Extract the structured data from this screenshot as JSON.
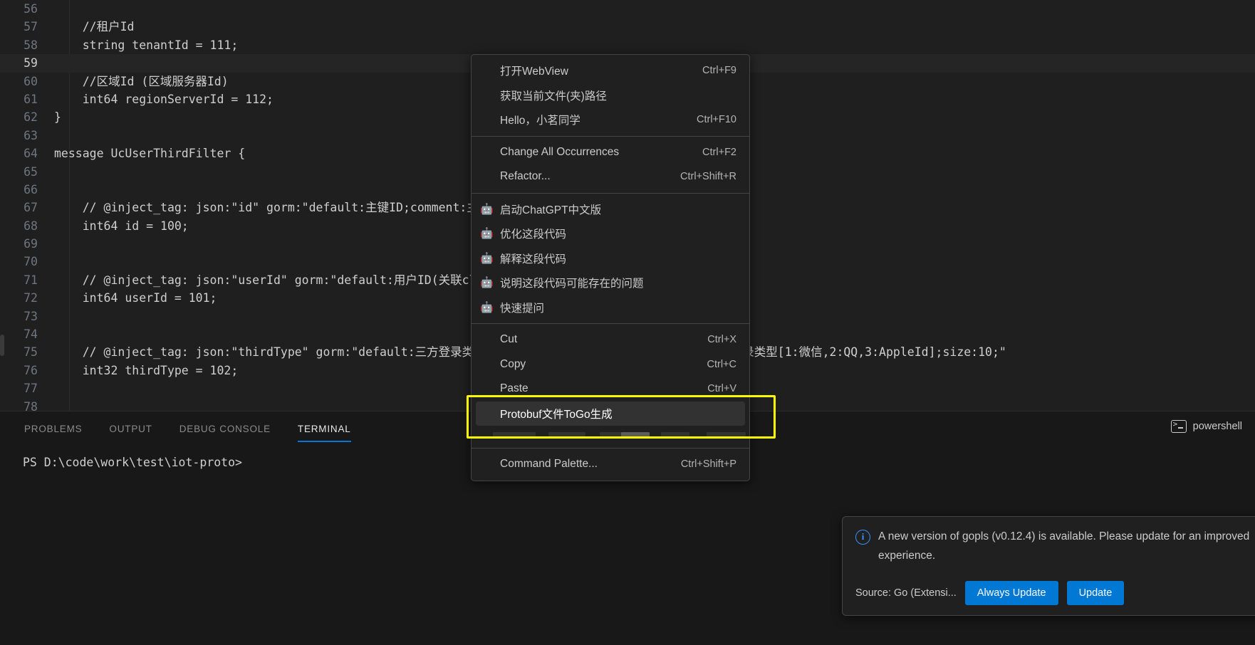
{
  "editor": {
    "lines": [
      {
        "n": "56",
        "text": "",
        "current": false
      },
      {
        "n": "57",
        "text": "    //租户Id",
        "current": false
      },
      {
        "n": "58",
        "text": "    string tenantId = 111;",
        "current": false
      },
      {
        "n": "59",
        "text": "",
        "current": true
      },
      {
        "n": "60",
        "text": "    //区域Id (区域服务器Id)",
        "current": false
      },
      {
        "n": "61",
        "text": "    int64 regionServerId = 112;",
        "current": false
      },
      {
        "n": "62",
        "text": "}",
        "current": false
      },
      {
        "n": "63",
        "text": "",
        "current": false
      },
      {
        "n": "64",
        "text": "message UcUserThirdFilter {",
        "current": false
      },
      {
        "n": "65",
        "text": "",
        "current": false
      },
      {
        "n": "66",
        "text": "",
        "current": false
      },
      {
        "n": "67",
        "text": "    // @inject_tag: json:\"id\" gorm:\"default:主键ID;comment:主键ID;size:19;\"",
        "current": false
      },
      {
        "n": "68",
        "text": "    int64 id = 100;",
        "current": false
      },
      {
        "n": "69",
        "text": "",
        "current": false
      },
      {
        "n": "70",
        "text": "",
        "current": false
      },
      {
        "n": "71",
        "text": "    // @inject_tag: json:\"userId\" gorm:\"default:用户ID(关联cloud_uc_user.id);size:19;\"",
        "current": false
      },
      {
        "n": "72",
        "text": "    int64 userId = 101;",
        "current": false
      },
      {
        "n": "73",
        "text": "",
        "current": false
      },
      {
        "n": "74",
        "text": "",
        "current": false
      },
      {
        "n": "75",
        "text": "    // @inject_tag: json:\"thirdType\" gorm:\"default:三方登录类型[1:微信,2:QQ,3:AppleId];comment:三方登录类型[1:微信,2:QQ,3:AppleId];size:10;\"",
        "current": false
      },
      {
        "n": "76",
        "text": "    int32 thirdType = 102;",
        "current": false
      },
      {
        "n": "77",
        "text": "",
        "current": false
      },
      {
        "n": "78",
        "text": "",
        "current": false
      }
    ]
  },
  "context_menu": {
    "groups": [
      {
        "items": [
          {
            "label": "打开WebView",
            "shortcut": "Ctrl+F9",
            "icon": "",
            "highlighted": false
          },
          {
            "label": "获取当前文件(夹)路径",
            "shortcut": "",
            "icon": "",
            "highlighted": false
          },
          {
            "label": "Hello，小茗同学",
            "shortcut": "Ctrl+F10",
            "icon": "",
            "highlighted": false
          }
        ]
      },
      {
        "items": [
          {
            "label": "Change All Occurrences",
            "shortcut": "Ctrl+F2",
            "icon": "",
            "highlighted": false
          },
          {
            "label": "Refactor...",
            "shortcut": "Ctrl+Shift+R",
            "icon": "",
            "highlighted": false
          }
        ]
      },
      {
        "items": [
          {
            "label": "启动ChatGPT中文版",
            "shortcut": "",
            "icon": "robot-icon",
            "glyph": "🤖",
            "highlighted": false
          },
          {
            "label": "优化这段代码",
            "shortcut": "",
            "icon": "robot-icon",
            "glyph": "🤖",
            "highlighted": false
          },
          {
            "label": "解释这段代码",
            "shortcut": "",
            "icon": "robot-icon",
            "glyph": "🤖",
            "highlighted": false
          },
          {
            "label": "说明这段代码可能存在的问题",
            "shortcut": "",
            "icon": "robot-icon",
            "glyph": "🤖",
            "highlighted": false
          },
          {
            "label": "快速提问",
            "shortcut": "",
            "icon": "robot-icon",
            "glyph": "🤖",
            "highlighted": false
          }
        ]
      },
      {
        "items": [
          {
            "label": "Cut",
            "shortcut": "Ctrl+X",
            "icon": "",
            "highlighted": false
          },
          {
            "label": "Copy",
            "shortcut": "Ctrl+C",
            "icon": "",
            "highlighted": false
          },
          {
            "label": "Paste",
            "shortcut": "Ctrl+V",
            "icon": "",
            "highlighted": false
          },
          {
            "label": "Protobuf文件ToGo生成",
            "shortcut": "",
            "icon": "",
            "highlighted": true
          }
        ]
      },
      {
        "items": [
          {
            "label": "Command Palette...",
            "shortcut": "Ctrl+Shift+P",
            "icon": "",
            "highlighted": false
          }
        ]
      }
    ],
    "highlight_color": "#ffff00"
  },
  "panel": {
    "tabs": [
      {
        "label": "PROBLEMS",
        "active": false
      },
      {
        "label": "OUTPUT",
        "active": false
      },
      {
        "label": "DEBUG CONSOLE",
        "active": false
      },
      {
        "label": "TERMINAL",
        "active": true
      }
    ],
    "terminal_name": "powershell",
    "terminal_icon": "powershell-icon",
    "prompt": "PS D:\\code\\work\\test\\iot-proto>"
  },
  "notification": {
    "icon": "info-icon",
    "message": "A new version of gopls (v0.12.4) is available. Please update for an improved experience.",
    "source_label": "Source: Go (Extensi...",
    "buttons": [
      {
        "label": "Always Update"
      },
      {
        "label": "Update"
      }
    ]
  },
  "colors": {
    "accent": "#0078d4",
    "highlight": "#ffff00",
    "editor_bg": "#1f1f1f",
    "menu_bg": "#202020",
    "info": "#3794ff"
  }
}
